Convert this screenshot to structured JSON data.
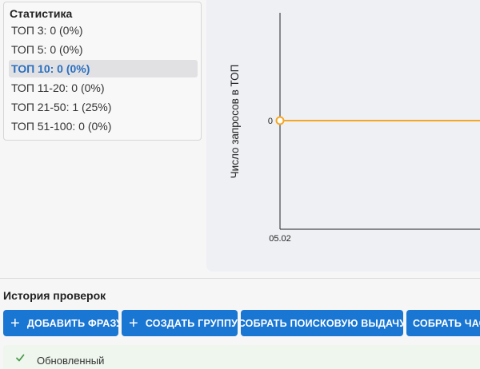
{
  "stats": {
    "title": "Статистика",
    "items": [
      {
        "label": "ТОП 3: 0 (0%)",
        "active": false
      },
      {
        "label": "ТОП 5: 0 (0%)",
        "active": false
      },
      {
        "label": "ТОП 10: 0 (0%)",
        "active": true
      },
      {
        "label": "ТОП 11-20: 0 (0%)",
        "active": false
      },
      {
        "label": "ТОП 21-50: 1 (25%)",
        "active": false
      },
      {
        "label": "ТОП 51-100: 0 (0%)",
        "active": false
      }
    ]
  },
  "chart_data": {
    "type": "line",
    "ylabel": "Число запросов в ТОП",
    "y_tick_labels": [
      "0"
    ],
    "x_tick_labels": [
      "05.02"
    ],
    "series": [
      {
        "x": [
          "05.02"
        ],
        "values": [
          0
        ],
        "color": "#f5a623"
      }
    ],
    "grid": false
  },
  "history": {
    "title": "История проверок",
    "buttons": [
      {
        "label": "ДОБАВИТЬ ФРАЗУ",
        "icon": "plus-icon"
      },
      {
        "label": "СОЗДАТЬ ГРУППУ",
        "icon": "plus-icon"
      },
      {
        "label": "СОБРАТЬ ПОИСКОВУЮ ВЫДАЧУ",
        "icon": ""
      },
      {
        "label": "СОБРАТЬ ЧАСТ",
        "icon": ""
      }
    ],
    "notice_text": "Обновленный"
  },
  "colors": {
    "accent": "#1976d2",
    "line": "#f5a623",
    "active_text": "#2a6fc0"
  }
}
